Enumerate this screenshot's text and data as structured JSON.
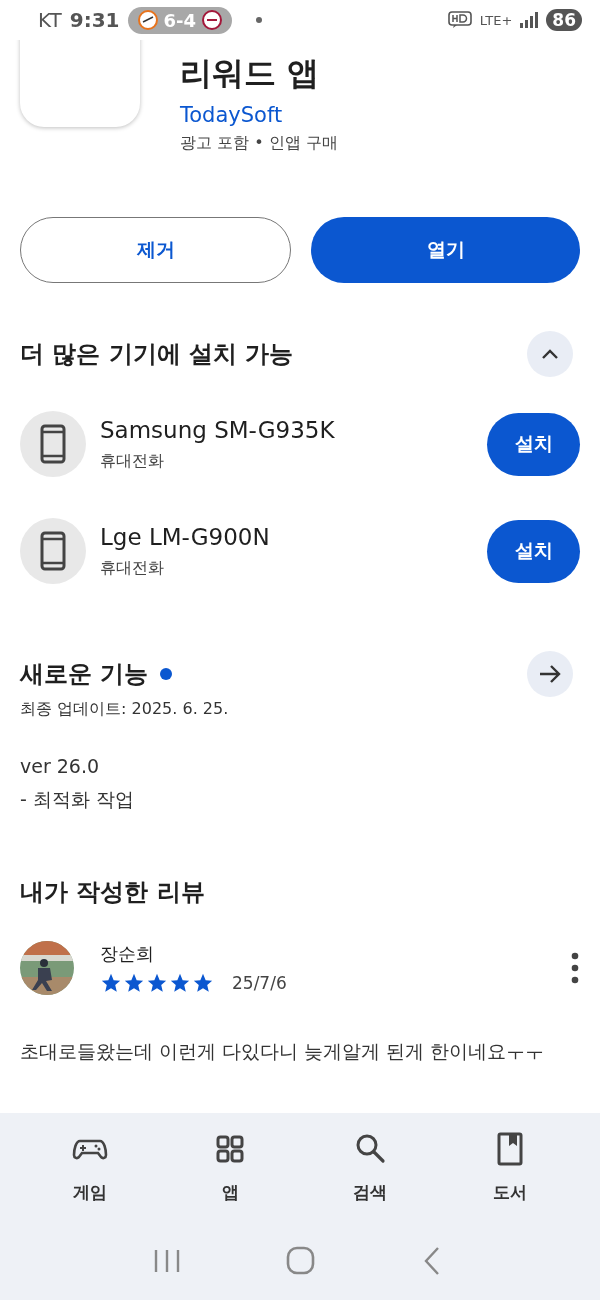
{
  "status_bar": {
    "carrier": "KT",
    "time": "9:31",
    "score": "6-4",
    "network": "LTE+",
    "battery": "86"
  },
  "app": {
    "title_lines": [
      "리워드 앱"
    ],
    "developer": "TodaySoft",
    "info": "광고 포함 • 인앱 구매"
  },
  "actions": [
    {
      "label": "제거",
      "kind": "outline"
    },
    {
      "label": "열기",
      "kind": "filled"
    }
  ],
  "devices_section": {
    "title": "더 많은 기기에 설치 가능",
    "expanded": true,
    "devices": [
      {
        "name": "Samsung SM-G935K",
        "type": "휴대전화",
        "button": "설치"
      },
      {
        "name": "Lge LM-G900N",
        "type": "휴대전화",
        "button": "설치"
      }
    ]
  },
  "whats_new": {
    "title": "새로운 기능",
    "updated": "최종 업데이트: 2025. 6. 25.",
    "lines": [
      "ver 26.0",
      "- 최적화 작업"
    ]
  },
  "my_review": {
    "title": "내가 작성한 리뷰",
    "author": "장순희",
    "stars": 5,
    "date": "25/7/6",
    "text": "초대로들왔는데 이런게 다있다니 늦게알게 된게 한이네요ㅜㅜ"
  },
  "bottom_nav": [
    {
      "label": "게임",
      "kind": "games"
    },
    {
      "label": "앱",
      "kind": "apps"
    },
    {
      "label": "검색",
      "kind": "search"
    },
    {
      "label": "도서",
      "kind": "books"
    }
  ]
}
